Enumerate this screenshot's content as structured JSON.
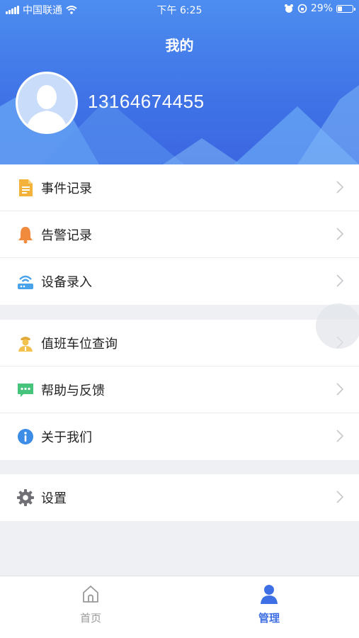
{
  "status_bar": {
    "carrier": "中国联通",
    "time": "下午 6:25",
    "battery": "29%",
    "battery_level": 0.29
  },
  "header": {
    "title": "我的",
    "phone": "13164674455"
  },
  "menu": {
    "group1": [
      {
        "label": "事件记录",
        "icon": "document-icon"
      },
      {
        "label": "告警记录",
        "icon": "bell-icon"
      },
      {
        "label": "设备录入",
        "icon": "router-icon"
      }
    ],
    "group2": [
      {
        "label": "值班车位查询",
        "icon": "officer-icon"
      },
      {
        "label": "帮助与反馈",
        "icon": "chat-icon"
      },
      {
        "label": "关于我们",
        "icon": "info-icon"
      }
    ],
    "group3": [
      {
        "label": "设置",
        "icon": "gear-icon"
      }
    ]
  },
  "tabbar": {
    "home": "首页",
    "manage": "管理"
  },
  "colors": {
    "accent": "#3e6fe4",
    "header_gradient_top": "#4d8df0",
    "header_gradient_bottom": "#3c67e2"
  }
}
